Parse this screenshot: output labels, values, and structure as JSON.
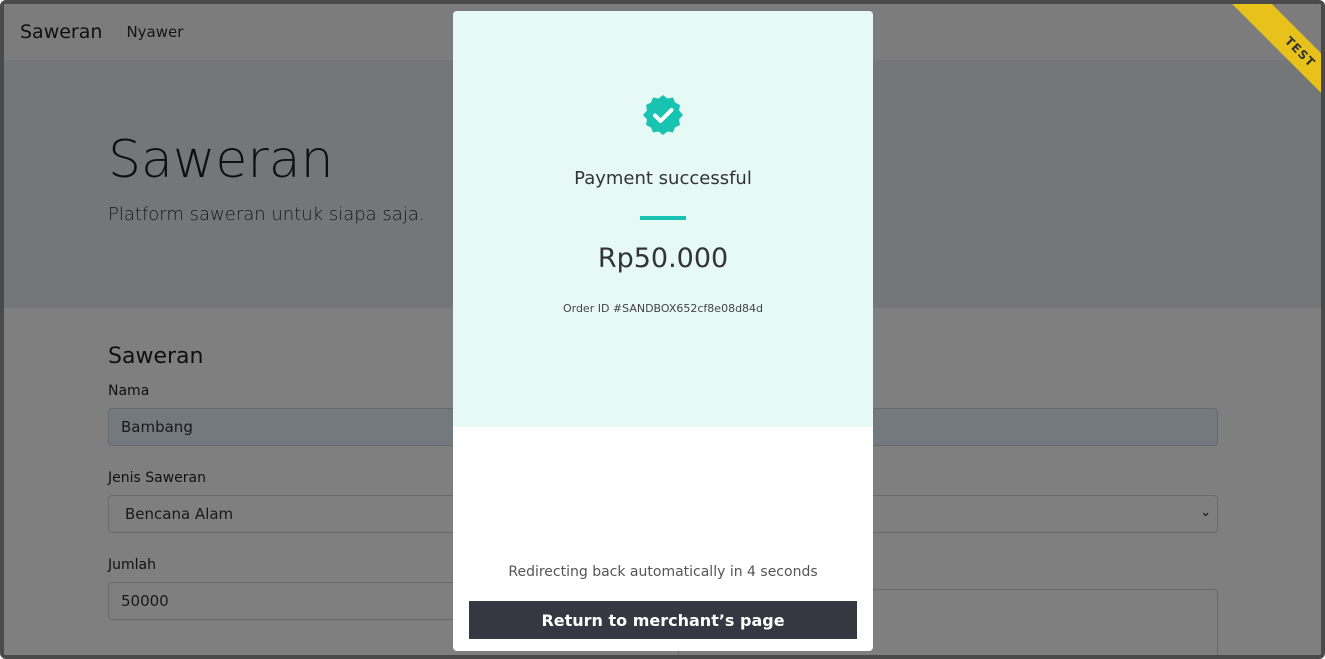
{
  "navbar": {
    "brand": "Saweran",
    "link": "Nyawer"
  },
  "hero": {
    "title": "Saweran",
    "lead": "Platform saweran untuk siapa saja."
  },
  "form": {
    "title": "Saweran",
    "nama_label": "Nama",
    "nama_value": "Bambang",
    "jenis_label": "Jenis Saweran",
    "jenis_value": "Bencana Alam",
    "jumlah_label": "Jumlah",
    "jumlah_value": "50000"
  },
  "ribbon": {
    "label": "TEST",
    "color": "#e8c21a"
  },
  "modal": {
    "icon": "check-badge-icon",
    "title": "Payment successful",
    "amount": "Rp50.000",
    "order_id": "Order ID #SANDBOX652cf8e08d84d",
    "redirect_text": "Redirecting back automatically in 4 seconds",
    "return_button": "Return to merchant’s page",
    "accent_color": "#18c4b1"
  }
}
